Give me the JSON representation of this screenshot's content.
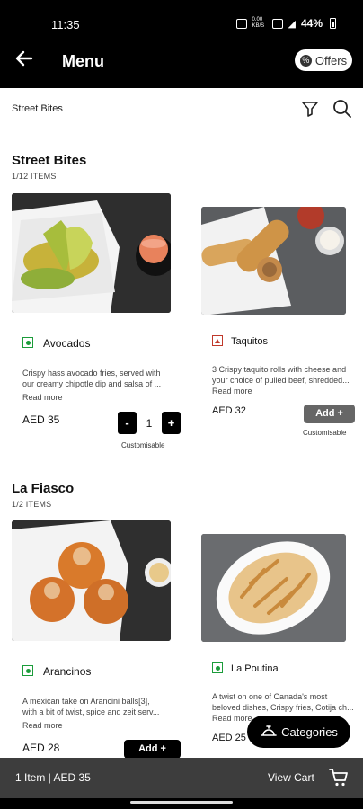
{
  "status_bar": {
    "time": "11:35",
    "battery": "44%",
    "net_speed": "0.00 KB/S"
  },
  "header": {
    "title": "Menu",
    "offers_label": "Offers"
  },
  "breadcrumb": "Street Bites",
  "sections": [
    {
      "title": "Street Bites",
      "count": "1/12 ITEMS",
      "items": [
        {
          "name": "Avocados",
          "desc_line1": "Crispy hass avocado fries, served with",
          "desc_line2": "our creamy chipotle dip and salsa of ...",
          "read_more": "Read more",
          "price": "AED 35",
          "qty": "1",
          "minus": "-",
          "plus": "+",
          "customisable": "Customisable"
        },
        {
          "name": "Taquitos",
          "desc_line1": "3 Crispy taquito rolls with cheese and",
          "desc_line2": "your choice of pulled beef, shredded...",
          "read_more": "Read more",
          "price": "AED 32",
          "add_label": "Add +",
          "customisable": "Customisable"
        }
      ]
    },
    {
      "title": "La Fiasco",
      "count": "1/2 ITEMS",
      "items": [
        {
          "name": "Arancinos",
          "desc_line1": "A mexican take on Arancini balls[3],",
          "desc_line2": "with a bit of twist, spice and zeit serv...",
          "read_more": "Read more",
          "price": "AED 28",
          "add_label": "Add +"
        },
        {
          "name": "La Poutina",
          "desc_line1": "A twist on one of Canada's most",
          "desc_line2": "beloved dishes, Crispy fries, Cotija ch...",
          "read_more": "Read more",
          "price": "AED 25"
        }
      ]
    }
  ],
  "floating": {
    "categories_label": "Categories"
  },
  "cart": {
    "summary": "1 Item | AED 35",
    "view_cart": "View Cart"
  },
  "colors": {
    "veg": "#1b9c3a",
    "nonveg": "#c0392b",
    "cart_bar": "#3d3d3d",
    "header": "#000000"
  }
}
